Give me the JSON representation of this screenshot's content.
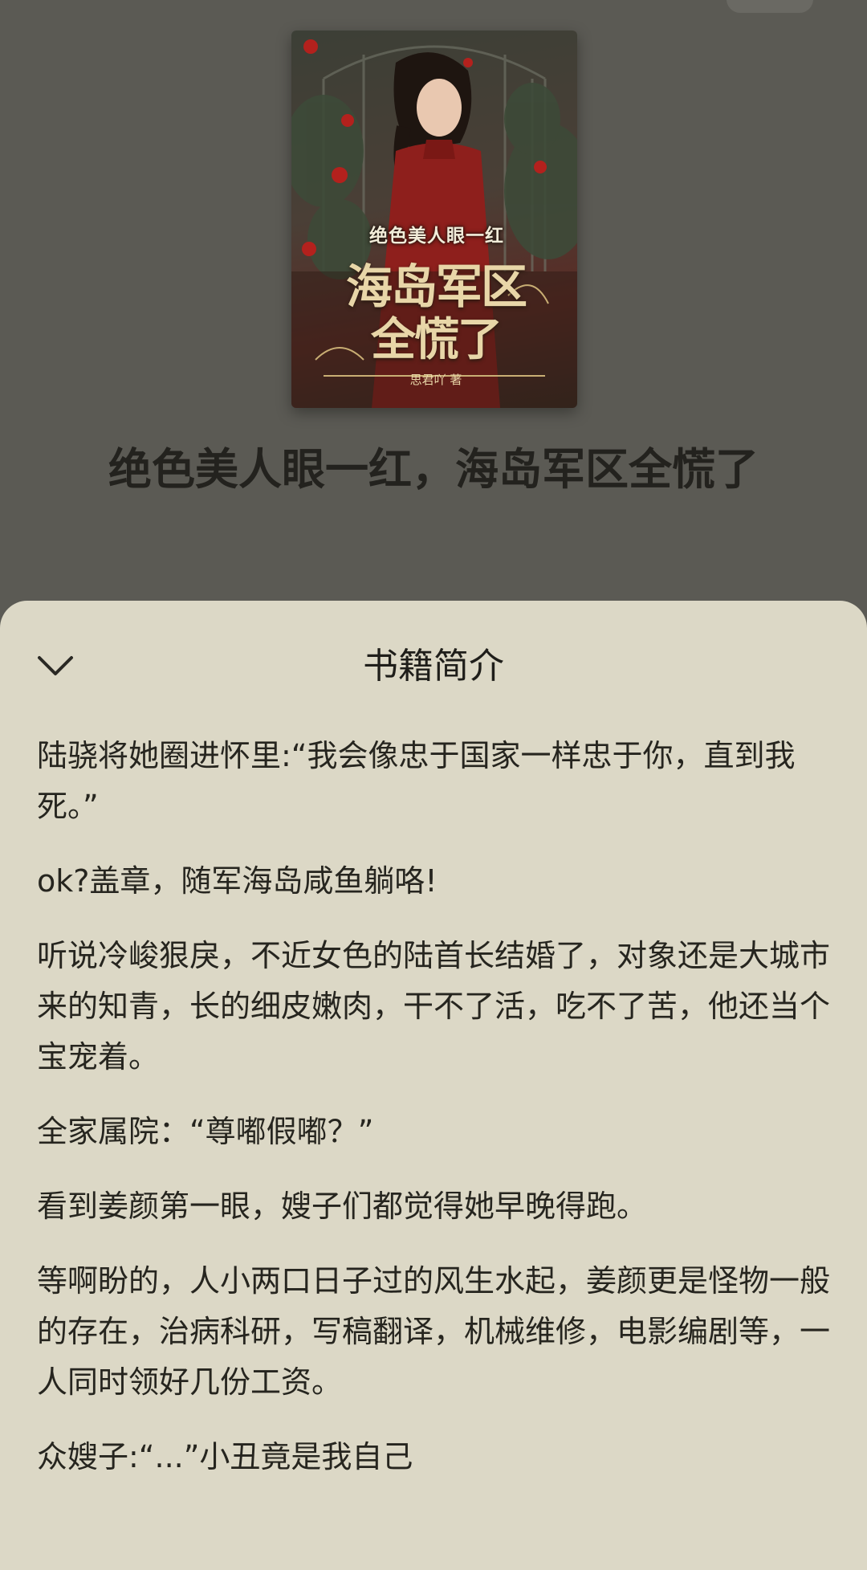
{
  "cover": {
    "subtitle": "绝色美人眼一红",
    "title_line1": "海岛军区",
    "title_line2": "全慌了",
    "author": "思君吖 著",
    "colors": {
      "dress": "#8e1f1c",
      "accent": "#e8d6a8",
      "foliage": "#3d4a38"
    }
  },
  "book": {
    "title": "绝色美人眼一红，海岛军区全慌了"
  },
  "sheet": {
    "title": "书籍简介",
    "collapse_icon": "chevron-down-icon",
    "paragraphs": [
      "陆骁将她圈进怀里:“我会像忠于国家一样忠于你，直到我死。”",
      "ok?盖章，随军海岛咸鱼躺咯!",
      "听说冷峻狠戾，不近女色的陆首长结婚了，对象还是大城市来的知青，长的细皮嫩肉，干不了活，吃不了苦，他还当个宝宠着。",
      "全家属院：“尊嘟假嘟？”",
      "看到姜颜第一眼，嫂子们都觉得她早晚得跑。",
      "等啊盼的，人小两口日子过的风生水起，姜颜更是怪物一般的存在，治病科研，写稿翻译，机械维修，电影编剧等，一人同时领好几份工资。",
      "众嫂子:“...”小丑竟是我自己"
    ]
  },
  "colors": {
    "backdrop": "#5b5a54",
    "sheet_bg": "#dcd8c6",
    "text": "#26251f"
  }
}
